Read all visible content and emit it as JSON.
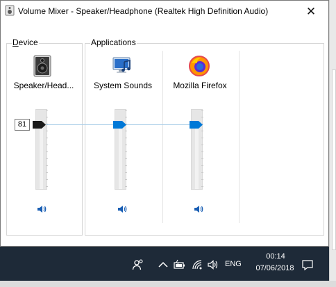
{
  "window": {
    "title": "Volume Mixer - Speaker/Headphone (Realtek High Definition Audio)",
    "close_symbol": "✕"
  },
  "device": {
    "group_label_accel": "D",
    "group_label_rest": "evice",
    "name": "Speaker/Head...",
    "icon": "speaker-device-icon",
    "volume": 81,
    "volume_label": "81",
    "mute_icon": "speaker-volume-icon"
  },
  "applications": {
    "group_label": "Applications",
    "items": [
      {
        "name": "System Sounds",
        "icon": "system-sounds-icon",
        "volume": 81,
        "mute_icon": "speaker-volume-icon"
      },
      {
        "name": "Mozilla Firefox",
        "icon": "firefox-icon",
        "volume": 81,
        "mute_icon": "speaker-volume-icon"
      }
    ]
  },
  "taskbar": {
    "language": "ENG",
    "time": "00:14",
    "date": "07/06/2018",
    "tray_icons": [
      "people-icon",
      "chevron-up-icon",
      "battery-icon",
      "wifi-icon",
      "volume-icon",
      "notification-icon"
    ]
  },
  "colors": {
    "accent": "#0078d7",
    "device_thumb": "#1a1a1a",
    "taskbar": "#1e2a38"
  }
}
